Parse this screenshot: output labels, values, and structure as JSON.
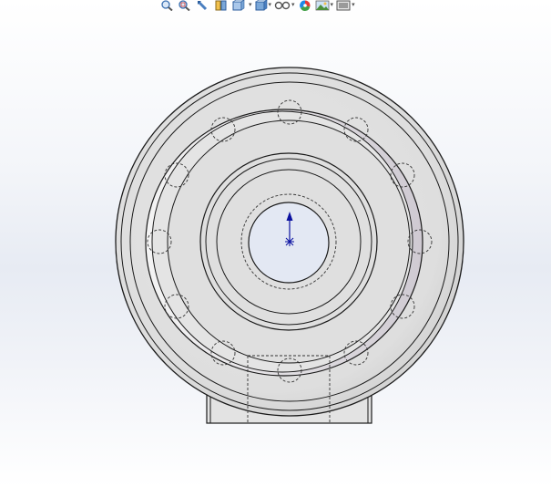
{
  "app": "SolidWorks",
  "colors": {
    "part_face": "#e2e2e2",
    "part_edge": "#1a1a1a",
    "hidden_line": "#333333",
    "bore_fill": "#e3e8f3",
    "axis_arrow": "#0a10a0"
  },
  "heads_up_toolbar": {
    "items": [
      {
        "name": "zoom-to-fit-icon",
        "dropdown": false
      },
      {
        "name": "zoom-to-area-icon",
        "dropdown": false
      },
      {
        "name": "previous-view-icon",
        "dropdown": false
      },
      {
        "name": "section-view-icon",
        "dropdown": false
      },
      {
        "name": "view-orientation-icon",
        "dropdown": true
      },
      {
        "name": "display-style-icon",
        "dropdown": true
      },
      {
        "name": "hide-show-items-icon",
        "dropdown": true
      },
      {
        "name": "edit-appearance-icon",
        "dropdown": false
      },
      {
        "name": "apply-scene-icon",
        "dropdown": true
      },
      {
        "name": "view-settings-icon",
        "dropdown": true
      }
    ],
    "dropdown_glyph": "▾"
  },
  "graphics_area": {
    "view": "front",
    "model": "pipe-flange-with-bolt-circle"
  }
}
